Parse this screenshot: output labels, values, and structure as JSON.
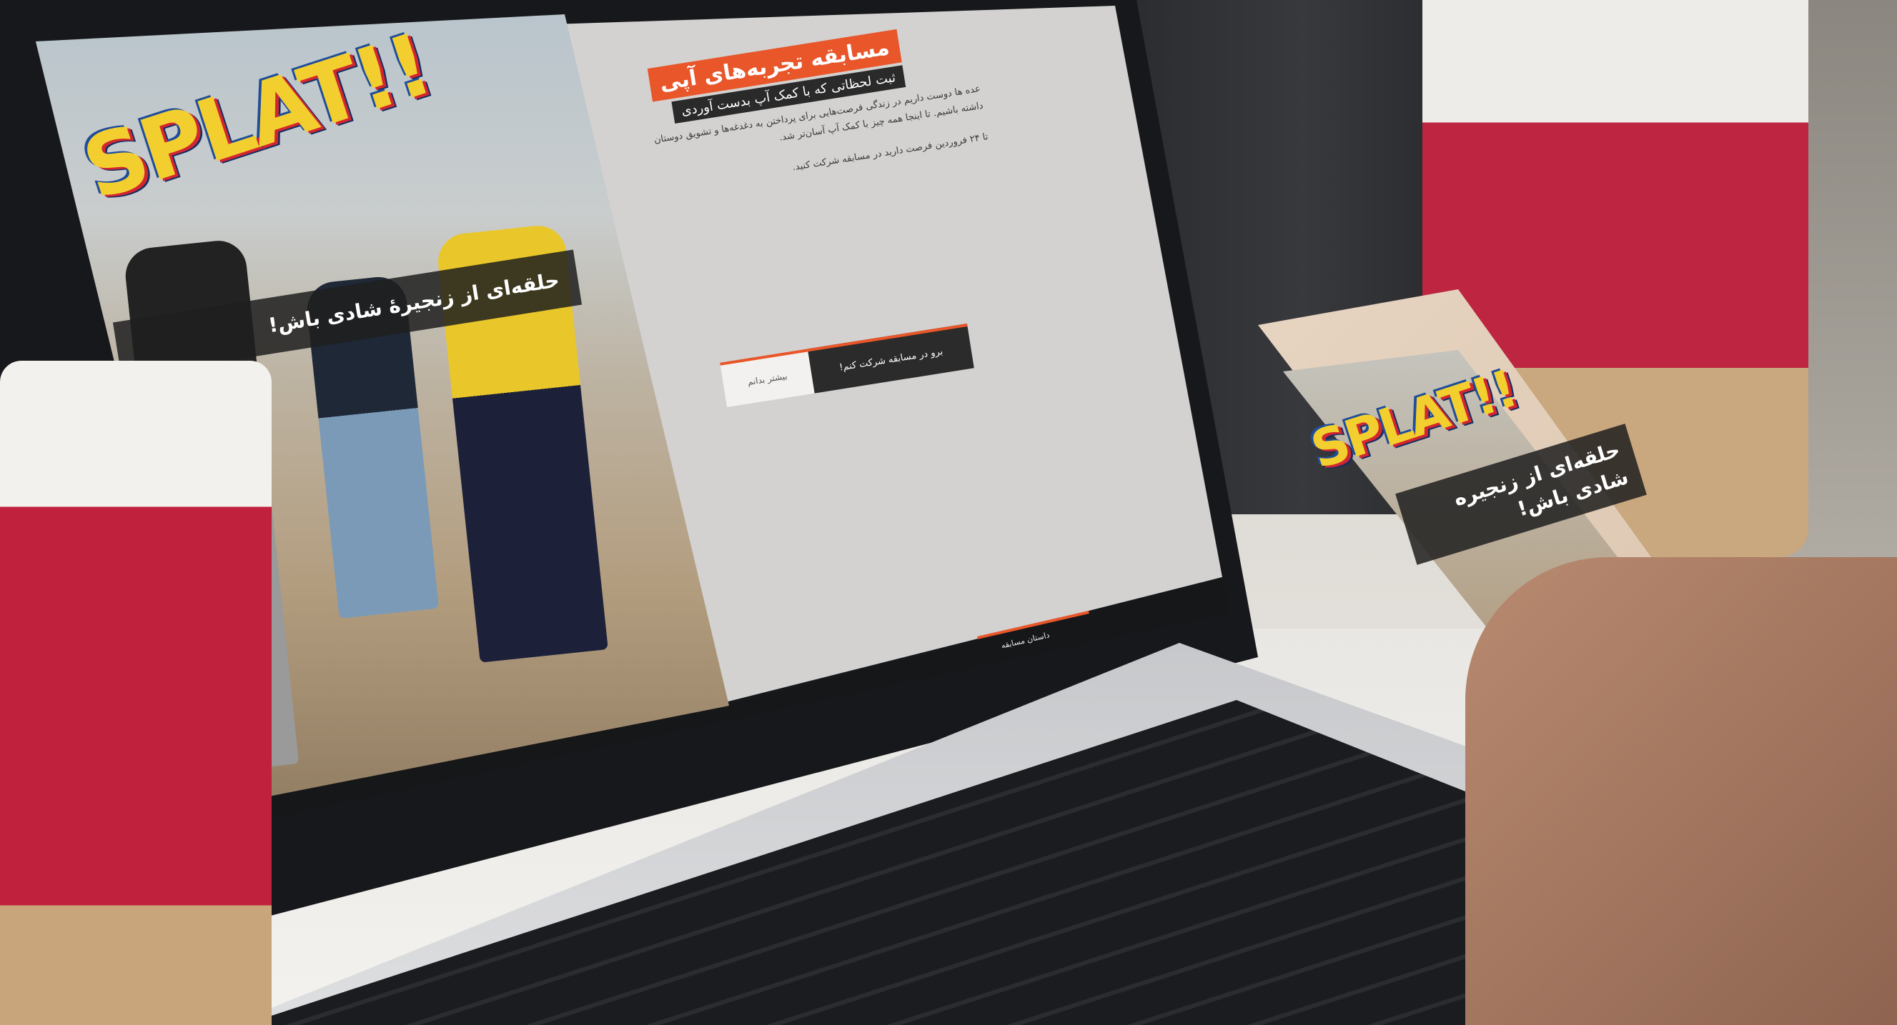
{
  "laptop_site": {
    "logo": "SPLAT!!",
    "hero_tagline": "حلقه‌ای از زنجیرهٔ شادی باش!",
    "title": "مسابقه تجربه‌های آپی",
    "subtitle": "ثبت لحظاتی که با کمک آپ بدست آوردی",
    "body": "عده ها دوست داریم در زندگی فرصت‌هایی برای پرداختن به دغدغه‌ها و تشویق دوستان داشته باشیم. تا اینجا همه چیز با کمک آپ آسان‌تر شد.",
    "footnote": "تا ۲۴ فروردین فرصت دارید در مسابقه شرکت کنید.",
    "join_button": "برو در مسابقه شرکت کنم!",
    "more_button": "بیشتر بدانم",
    "nav": [
      "داستان مسابقه",
      "",
      "",
      "",
      ""
    ]
  },
  "phone_site": {
    "logo": "SPLAT!!",
    "hero_tagline": "حلقه‌ای از زنجیره شادی باش!"
  },
  "colors": {
    "accent": "#e8562a",
    "dark": "#2b2b2b",
    "cup_red": "#c0213c",
    "logo_yellow": "#f2cf2f"
  }
}
